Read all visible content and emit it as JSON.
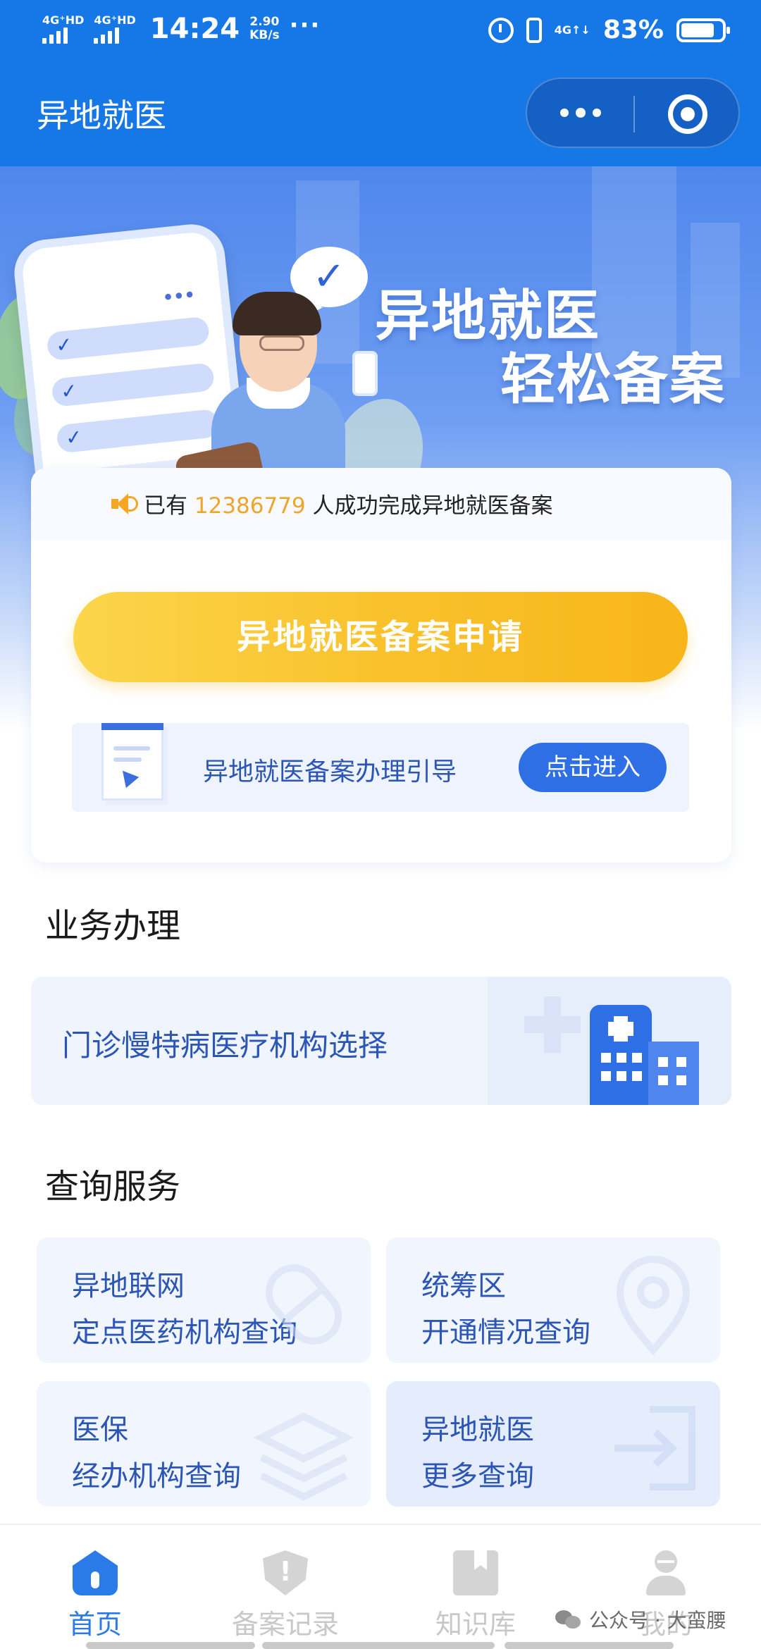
{
  "status_bar": {
    "signal_1": "4G⁺HD",
    "signal_2": "4G⁺HD",
    "time": "14:24",
    "rate_value": "2.90",
    "rate_unit": "KB/s",
    "more": "···",
    "net_type": "4G↑↓",
    "battery_pct": "83%",
    "battery_level": 0.83
  },
  "header": {
    "title": "异地就医"
  },
  "banner": {
    "slogan_line1": "异地就医",
    "slogan_line2": "轻松备案",
    "bubble_icon": "check-bubble-icon"
  },
  "card": {
    "notice_prefix": "已有",
    "notice_count": "12386779",
    "notice_suffix": "人成功完成异地就医备案",
    "apply_button": "异地就医备案申请",
    "guide_text": "异地就医备案办理引导",
    "guide_button": "点击进入"
  },
  "business": {
    "section_title": "业务办理",
    "item": "门诊慢特病医疗机构选择"
  },
  "query": {
    "section_title": "查询服务",
    "items": [
      {
        "line1": "异地联网",
        "line2": "定点医药机构查询",
        "icon": "capsule-icon"
      },
      {
        "line1": "统筹区",
        "line2": "开通情况查询",
        "icon": "location-pin-icon"
      },
      {
        "line1": "医保",
        "line2": "经办机构查询",
        "icon": "layers-icon"
      },
      {
        "line1": "异地就医",
        "line2": "更多查询",
        "icon": "exit-arrow-icon"
      }
    ]
  },
  "tabbar": {
    "tabs": [
      {
        "label": "首页",
        "icon": "home-icon",
        "active": true
      },
      {
        "label": "备案记录",
        "icon": "shield-icon",
        "active": false
      },
      {
        "label": "知识库",
        "icon": "book-icon",
        "active": false
      },
      {
        "label": "我的",
        "icon": "user-icon",
        "active": false
      }
    ]
  },
  "watermark": "公众号 · 大蛮腰",
  "colors": {
    "primary": "#1677e6",
    "accent_yellow": "#f9c22c",
    "highlight_count": "#f0a52a",
    "link_blue": "#2b56b5"
  }
}
